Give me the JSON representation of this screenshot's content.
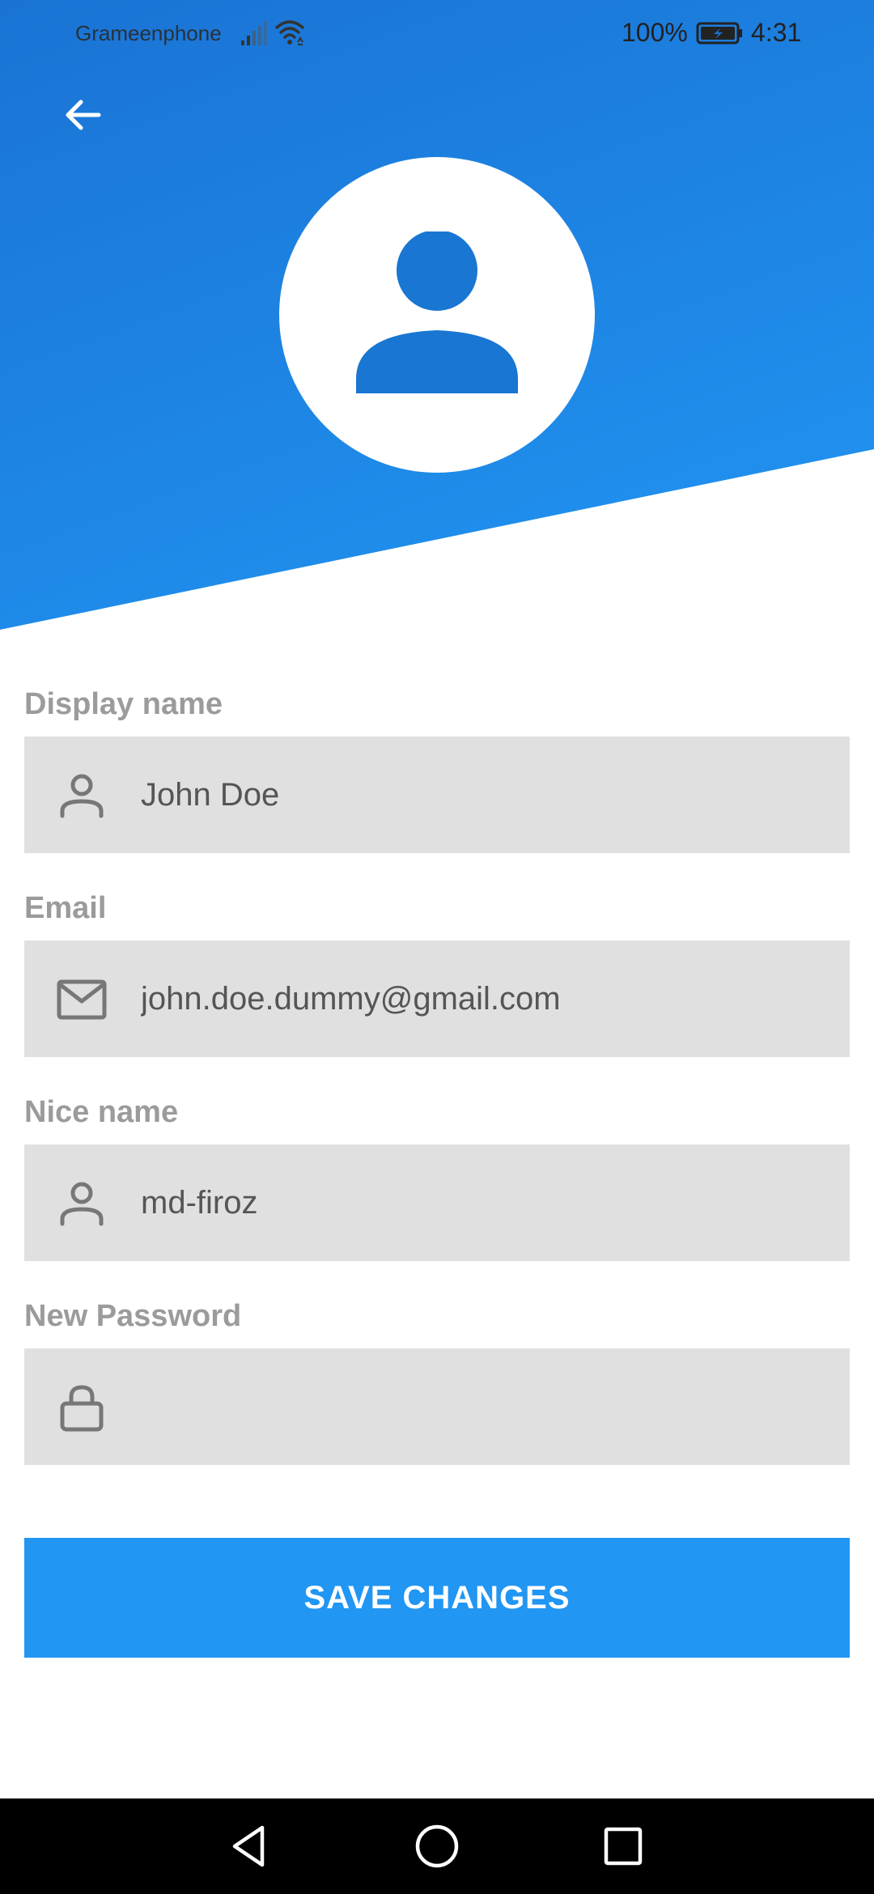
{
  "status_bar": {
    "carrier": "Grameenphone",
    "battery_percent": "100%",
    "time": "4:31",
    "icons": [
      "signal-icon",
      "wifi-icon",
      "battery-charging-icon"
    ]
  },
  "header": {
    "back_icon": "arrow-left-icon",
    "avatar_icon": "person-icon",
    "colors": {
      "gradient_start": "#1A73D4",
      "gradient_end": "#2196F3"
    }
  },
  "form": {
    "fields": [
      {
        "label": "Display name",
        "value": "John Doe",
        "icon": "person-outline-icon"
      },
      {
        "label": "Email",
        "value": "john.doe.dummy@gmail.com",
        "icon": "mail-icon"
      },
      {
        "label": "Nice name",
        "value": "md-firoz",
        "icon": "person-outline-icon"
      },
      {
        "label": "New Password",
        "value": "",
        "icon": "lock-icon"
      }
    ]
  },
  "save_button": {
    "label": "SAVE CHANGES",
    "color": "#2196F3"
  },
  "nav_bar": {
    "icons": [
      "back-triangle-icon",
      "home-circle-icon",
      "recents-square-icon"
    ]
  }
}
